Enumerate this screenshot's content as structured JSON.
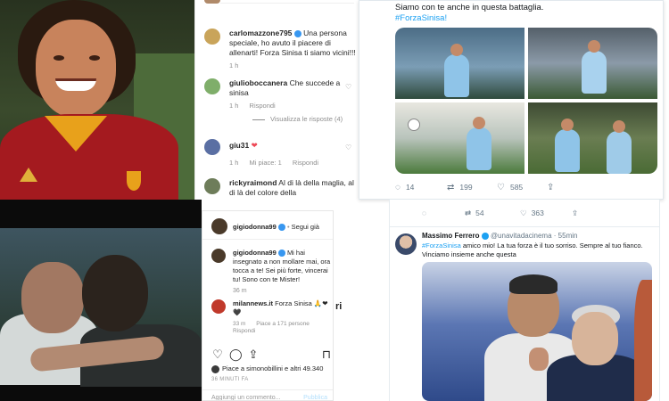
{
  "instagram_comments": [
    {
      "username": "carlomazzone795",
      "verified": true,
      "text": "Una persona speciale, ho avuto il piacere di allenarti! Forza Sinisa ti siamo vicini!!!",
      "time": "1 h",
      "avatar_color": "#c9a45a"
    },
    {
      "username": "giulioboccanera",
      "text": "Che succede a sinisa",
      "time": "1 h",
      "reply_label": "Rispondi",
      "view_replies": "Visualizza le risposte (4)",
      "avatar_color": "#7fae6a"
    },
    {
      "username": "giu31",
      "heart": "❤",
      "time": "1 h",
      "likes": "Mi piace: 1",
      "reply_label": "Rispondi",
      "avatar_color": "#5a6fa3"
    },
    {
      "username": "rickyraimond",
      "text": "Al di là della maglia, al di là del colore della",
      "avatar_color": "#6e7d5a"
    }
  ],
  "instagram_post": {
    "author": "gigiodonna99",
    "verified": true,
    "follow_label": "Segui già",
    "caption_user": "gigiodonna99",
    "caption": "Mi hai insegnato a non mollare mai, ora tocca a te! Sei più forte, vincerai tu! Sono con te Mister!",
    "caption_time": "36 m",
    "comment_user": "milannews.it",
    "comment_text": "Forza Sinisa 🙏❤🖤",
    "comment_time": "33 m",
    "comment_likes": "Piace a 171 persone",
    "reply_label": "Rispondi",
    "liked_by": "Piace a simonobillini e altri 49.340",
    "time_ago": "36 MINUTI FA",
    "add_comment_placeholder": "Aggiungi un commento...",
    "publish_label": "Pubblica",
    "side_letters": "ri",
    "avatar_color": "#4a3a2a",
    "comment_avatar_color": "#c0392b",
    "liker_avatar_color": "#3a3a3a"
  },
  "tweet_top": {
    "text": "Siamo con te anche in questa battaglia.",
    "hashtag": "#ForzaSinisa!",
    "replies": "14",
    "retweets": "199",
    "likes": "585"
  },
  "tweet_bottom": {
    "prev_retweets": "54",
    "prev_likes": "363",
    "name": "Massimo Ferrero",
    "verified": true,
    "handle": "@unavitadacinema",
    "time": "55min",
    "hashtag": "#ForzaSinisa",
    "text": "amico mio! La tua forza è il tuo sorriso. Sempre al tuo fianco. Vinciamo insieme anche questa"
  },
  "colors": {
    "twitter_blue": "#1da1f2",
    "instagram_blue": "#3897f0",
    "heart_red": "#ed4956",
    "muted_gray": "#8e8e8e"
  }
}
